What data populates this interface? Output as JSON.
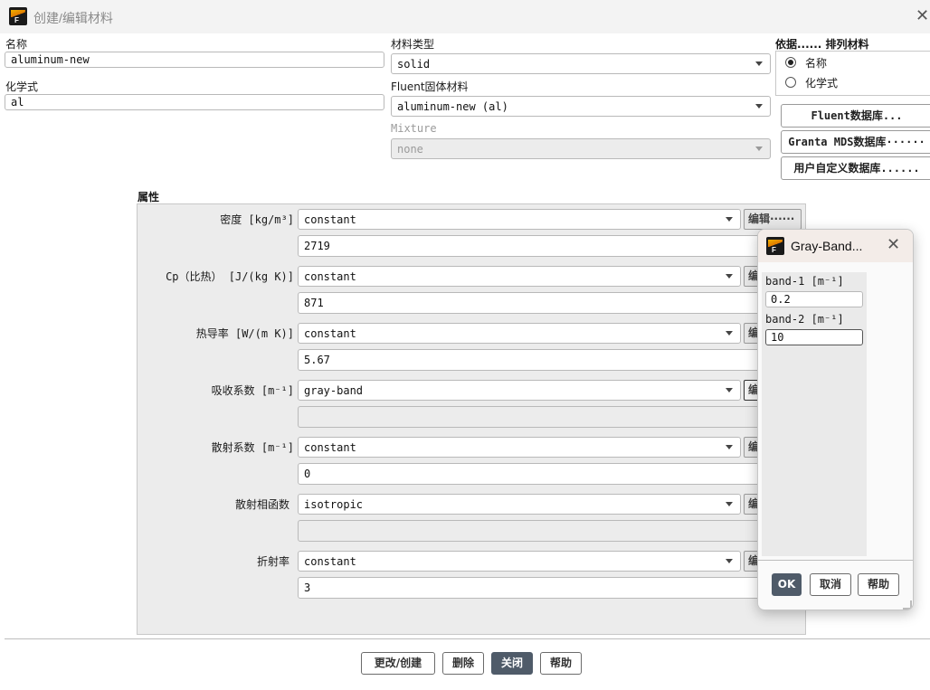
{
  "window": {
    "title": "创建/编辑材料",
    "app_icon_letter": "F"
  },
  "name_field": {
    "label": "名称",
    "value": "aluminum-new"
  },
  "formula_field": {
    "label": "化学式",
    "value": "al"
  },
  "material_type": {
    "label": "材料类型",
    "value": "solid"
  },
  "fluent_solid": {
    "label": "Fluent固体材料",
    "value": "aluminum-new (al)"
  },
  "mixture": {
    "label": "Mixture",
    "value": "none"
  },
  "sort_by": {
    "label": "依据...... 排列材料",
    "options": [
      "名称",
      "化学式"
    ],
    "selected": 0
  },
  "databases": {
    "fluent": "Fluent数据库...",
    "granta": "Granta MDS数据库······",
    "user": "用户自定义数据库......"
  },
  "properties": {
    "header": "属性",
    "edit_label": "编辑······",
    "edit_short": "编",
    "rows": [
      {
        "label": "密度 [kg/m³]",
        "method": "constant",
        "value": "2719"
      },
      {
        "label": "Cp（比热） [J/(kg K)]",
        "method": "constant",
        "value": "871"
      },
      {
        "label": "热导率 [W/(m K)]",
        "method": "constant",
        "value": "5.67"
      },
      {
        "label": "吸收系数 [m⁻¹]",
        "method": "gray-band",
        "value": ""
      },
      {
        "label": "散射系数 [m⁻¹]",
        "method": "constant",
        "value": "0"
      },
      {
        "label": "散射相函数",
        "method": "isotropic",
        "value": ""
      },
      {
        "label": "折射率",
        "method": "constant",
        "value": "3"
      }
    ]
  },
  "footer": {
    "change": "更改/创建",
    "delete": "删除",
    "close": "关闭",
    "help": "帮助"
  },
  "popup": {
    "title": "Gray-Band...",
    "band1": {
      "label": "band-1 [m⁻¹]",
      "value": "0.2"
    },
    "band2": {
      "label": "band-2 [m⁻¹]",
      "value": "10"
    },
    "ok": "OK",
    "cancel": "取消",
    "help": "帮助"
  }
}
